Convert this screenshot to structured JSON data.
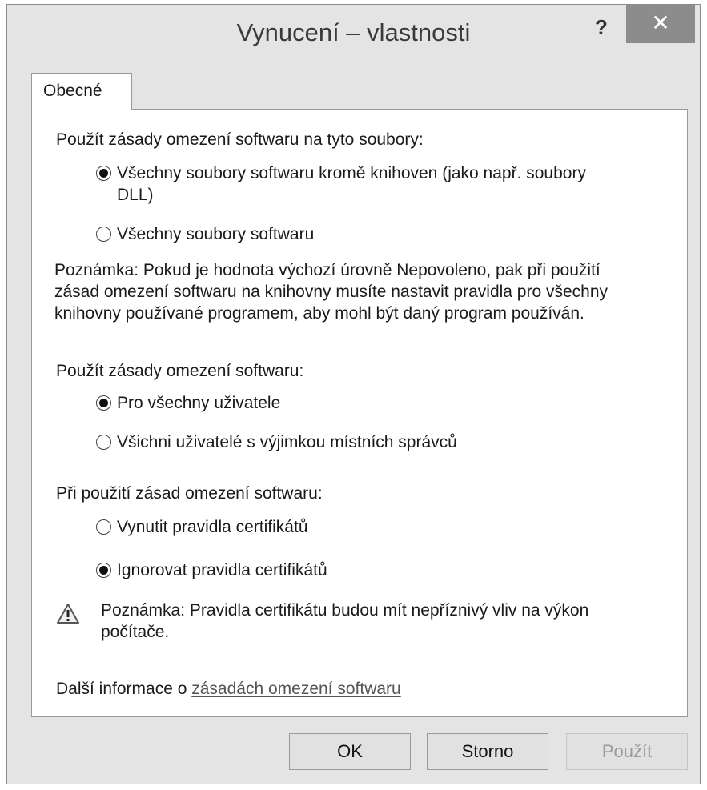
{
  "window": {
    "title": "Vynucení – vlastnosti",
    "help_label": "?",
    "close_label": "✕"
  },
  "tabs": [
    {
      "label": "Obecné"
    }
  ],
  "section1": {
    "heading": "Použít zásady omezení softwaru na tyto soubory:",
    "options": [
      {
        "label_line1": "Všechny soubory softwaru kromě knihoven (jako např. soubory",
        "label_line2": "DLL)",
        "selected": true
      },
      {
        "label": "Všechny soubory softwaru",
        "selected": false
      }
    ],
    "note_lines": [
      "Poznámka: Pokud je hodnota výchozí úrovně Nepovoleno, pak při použití",
      "zásad omezení softwaru na knihovny musíte nastavit pravidla pro všechny",
      "knihovny používané programem, aby mohl být daný program používán."
    ]
  },
  "section2": {
    "heading": "Použít zásady omezení softwaru:",
    "options": [
      {
        "label": "Pro všechny uživatele",
        "selected": true
      },
      {
        "label": "Všichni uživatelé s výjimkou místních správců",
        "selected": false
      }
    ]
  },
  "section3": {
    "heading": "Při použití zásad omezení softwaru:",
    "options": [
      {
        "label": "Vynutit pravidla certifikátů",
        "selected": false
      },
      {
        "label": "Ignorovat pravidla certifikátů",
        "selected": true
      }
    ],
    "warning_lines": [
      "Poznámka: Pravidla certifikátu budou mít nepříznivý vliv na výkon",
      "počítače."
    ]
  },
  "more_info": {
    "prefix": "Další informace o ",
    "link": "zásadách omezení softwaru"
  },
  "buttons": {
    "ok": "OK",
    "cancel": "Storno",
    "apply": "Použít",
    "apply_enabled": false
  },
  "colors": {
    "close_button_bg": "#8c8c8c",
    "dialog_bg": "#e4e4e4",
    "panel_bg": "#ffffff"
  },
  "icons": {
    "help": "question-mark",
    "close": "close-x",
    "warning": "warning-triangle",
    "radio_selected": "radio-filled",
    "radio_unselected": "radio-empty"
  }
}
